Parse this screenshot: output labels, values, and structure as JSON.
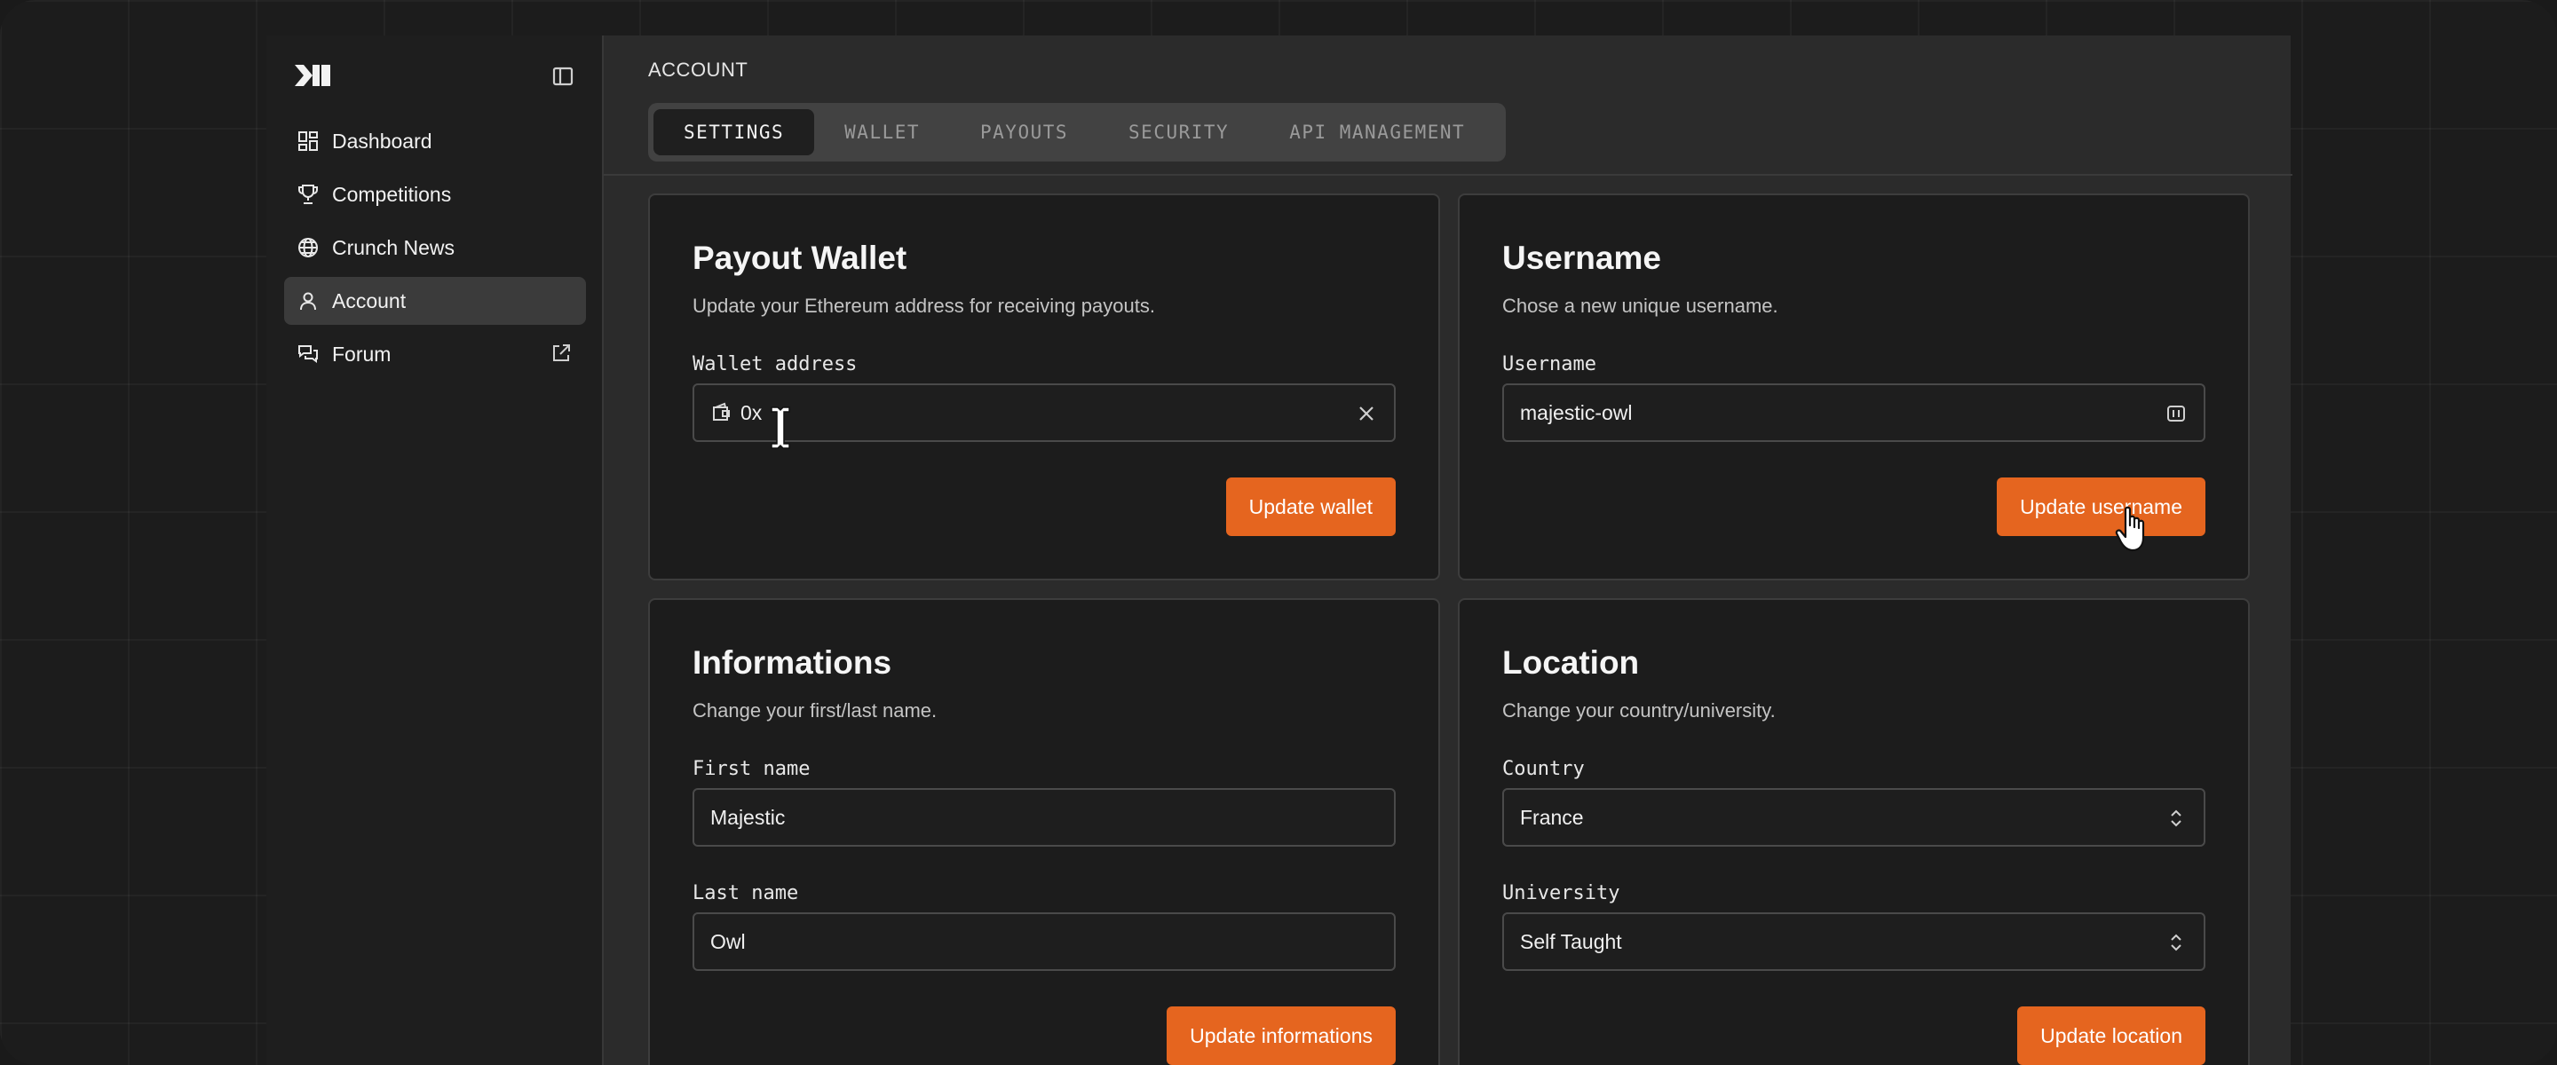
{
  "sidebar": {
    "items": [
      {
        "label": "Dashboard",
        "icon": "dashboard-icon"
      },
      {
        "label": "Competitions",
        "icon": "trophy-icon"
      },
      {
        "label": "Crunch News",
        "icon": "globe-icon"
      },
      {
        "label": "Account",
        "icon": "user-icon",
        "active": true
      },
      {
        "label": "Forum",
        "icon": "chat-icon",
        "external": true
      }
    ]
  },
  "breadcrumb": "ACCOUNT",
  "tabs": [
    "SETTINGS",
    "WALLET",
    "PAYOUTS",
    "SECURITY",
    "API MANAGEMENT"
  ],
  "active_tab": "SETTINGS",
  "payout_wallet": {
    "title": "Payout Wallet",
    "description": "Update your Ethereum address for receiving payouts.",
    "field_label": "Wallet address",
    "value": "0x",
    "button": "Update wallet"
  },
  "username": {
    "title": "Username",
    "description": "Chose a new unique username.",
    "field_label": "Username",
    "value": "majestic-owl",
    "button": "Update username"
  },
  "informations": {
    "title": "Informations",
    "description": "Change your first/last name.",
    "first_label": "First name",
    "first_value": "Majestic",
    "last_label": "Last name",
    "last_value": "Owl",
    "button": "Update informations"
  },
  "location": {
    "title": "Location",
    "description": "Change your country/university.",
    "country_label": "Country",
    "country_value": "France",
    "university_label": "University",
    "university_value": "Self Taught",
    "button": "Update location"
  },
  "colors": {
    "accent": "#e5651f",
    "card_bg": "#1c1c1c",
    "main_bg": "#2b2b2b"
  }
}
